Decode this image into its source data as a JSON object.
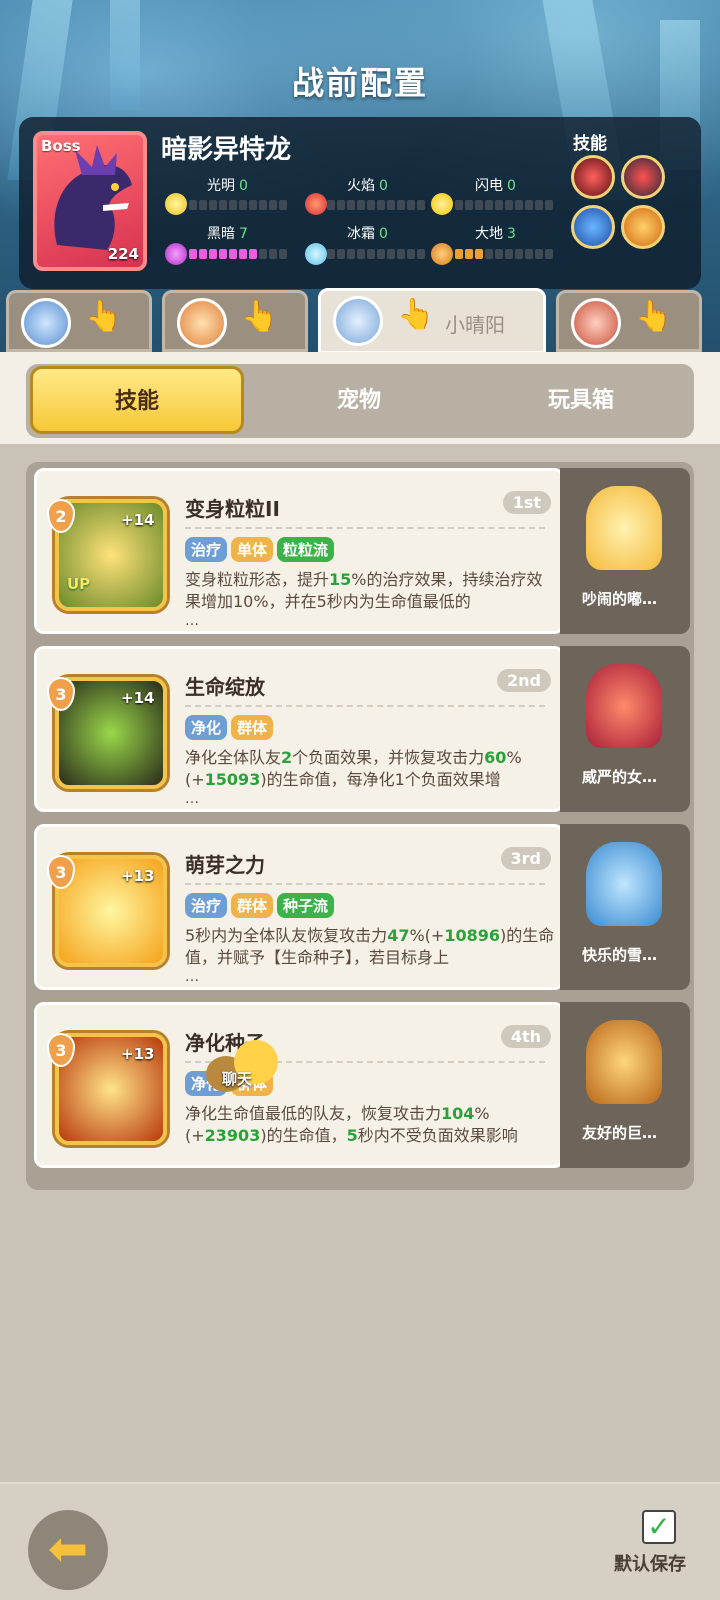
{
  "header": {
    "title": "战前配置"
  },
  "boss": {
    "tag": "Boss",
    "level": "224",
    "name": "暗影异特龙",
    "elements": [
      {
        "label": "光明",
        "value": "0",
        "fill": 0
      },
      {
        "label": "火焰",
        "value": "0",
        "fill": 0
      },
      {
        "label": "闪电",
        "value": "0",
        "fill": 0
      },
      {
        "label": "黑暗",
        "value": "7",
        "fill": 7
      },
      {
        "label": "冰霜",
        "value": "0",
        "fill": 0
      },
      {
        "label": "大地",
        "value": "3",
        "fill": 3
      }
    ],
    "skills_label": "技能",
    "skill_icons": [
      "bite-icon",
      "dragon-head-icon",
      "lightning-icon",
      "crown-icon"
    ]
  },
  "hero_tabs": [
    {
      "avatar": "hero-blue-hair-avatar",
      "name": ""
    },
    {
      "avatar": "hero-bird-avatar",
      "name": ""
    },
    {
      "avatar": "hero-silver-hair-avatar",
      "name": "小晴阳",
      "active": true
    },
    {
      "avatar": "hero-red-hair-avatar",
      "name": ""
    }
  ],
  "tabs": {
    "skills": "技能",
    "pets": "宠物",
    "toybox": "玩具箱"
  },
  "cards": [
    {
      "level": "2",
      "plus": "+14",
      "up": "UP",
      "title": "变身粒粒II",
      "rank": "1st",
      "tags": [
        {
          "text": "治疗",
          "kind": "blue"
        },
        {
          "text": "单体",
          "kind": "gold"
        },
        {
          "text": "粒粒流",
          "kind": "green"
        }
      ],
      "desc_html": "变身粒粒形态，提升<span class='hl'>15</span>%的治疗效果，持续治疗效果增加10%，并在5秒内为生命值最低的",
      "ellipsis": "…",
      "pet": "吵闹的嘟…"
    },
    {
      "level": "3",
      "plus": "+14",
      "up": "",
      "title": "生命绽放",
      "rank": "2nd",
      "tags": [
        {
          "text": "净化",
          "kind": "blue"
        },
        {
          "text": "群体",
          "kind": "gold"
        }
      ],
      "desc_html": "净化全体队友<span class='hl'>2</span>个负面效果，并恢复攻击力<span class='hl'>60</span>%(+<span class='hl'>15093</span>)的生命值，每净化1个负面效果增",
      "ellipsis": "…",
      "pet": "威严的女…"
    },
    {
      "level": "3",
      "plus": "+13",
      "up": "",
      "title": "萌芽之力",
      "rank": "3rd",
      "tags": [
        {
          "text": "治疗",
          "kind": "blue"
        },
        {
          "text": "群体",
          "kind": "gold"
        },
        {
          "text": "种子流",
          "kind": "green"
        }
      ],
      "desc_html": "5秒内为全体队友恢复攻击力<span class='hl'>47</span>%(+<span class='hl'>10896</span>)的生命值，并赋予【生命种子】，若目标身上",
      "ellipsis": "…",
      "pet": "快乐的雪…"
    },
    {
      "level": "3",
      "plus": "+13",
      "up": "",
      "title": "净化种子",
      "rank": "4th",
      "tags": [
        {
          "text": "净化",
          "kind": "blue"
        },
        {
          "text": "群体",
          "kind": "gold"
        }
      ],
      "desc_html": "净化生命值最低的队友，恢复攻击力<span class='hl'>104</span>%(+<span class='hl'>23903</span>)的生命值，<span class='hl'>5</span>秒内不受负面效果影响",
      "ellipsis": "",
      "pet": "友好的巨…"
    }
  ],
  "chat": {
    "label": "聊天"
  },
  "footer": {
    "save_label": "默认保存"
  },
  "colors": {
    "accent": "#f7c838",
    "highlight": "#2aa23a",
    "boss_border": "#ff8b8b"
  }
}
